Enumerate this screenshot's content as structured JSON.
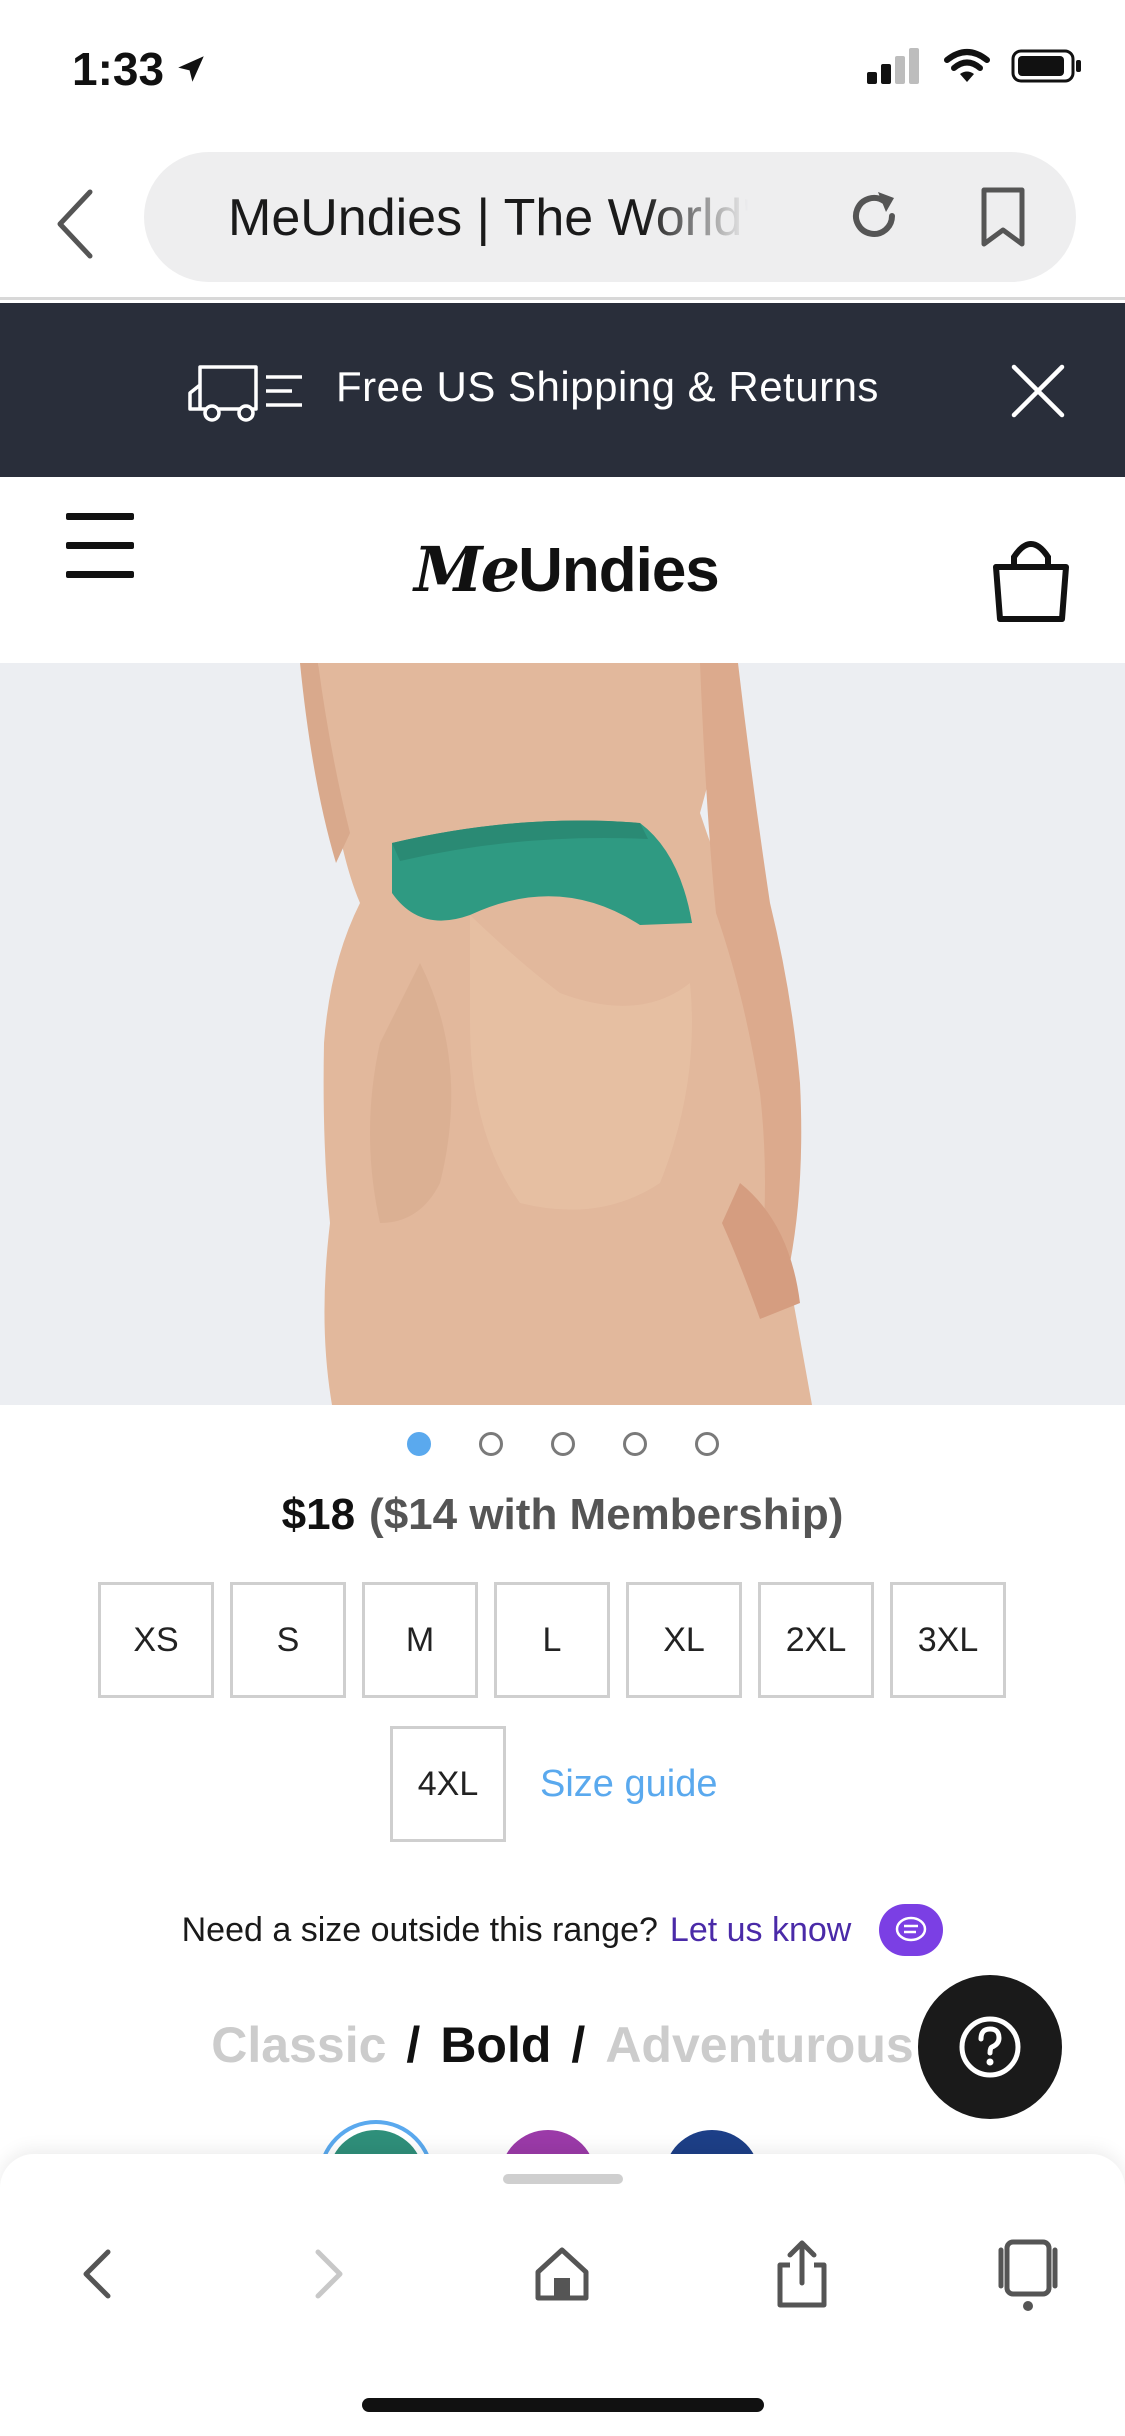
{
  "status_bar": {
    "time": "1:33"
  },
  "browser": {
    "url_text": "MeUndies | The World'",
    "icons": [
      "back-icon",
      "reload-icon",
      "bookmark-icon"
    ]
  },
  "banner": {
    "text": "Free US Shipping & Returns",
    "icons": [
      "truck-icon",
      "close-icon"
    ]
  },
  "header": {
    "logo_me": "Me",
    "logo_undies": "Undies",
    "icons": [
      "hamburger-menu-icon",
      "shopping-bag-icon"
    ]
  },
  "carousel": {
    "total": 5,
    "active_index": 0,
    "active_color": "#5aa9ee"
  },
  "product": {
    "price": "$18",
    "member_price": "($14 with Membership)",
    "sizes": [
      "XS",
      "S",
      "M",
      "L",
      "XL",
      "2XL",
      "3XL"
    ],
    "sizes_row2": [
      "4XL"
    ],
    "size_guide": "Size guide",
    "need_size_text": "Need a size outside this range?",
    "need_size_link": "Let us know",
    "style_tabs": [
      {
        "label": "Classic",
        "active": false
      },
      {
        "label": "Bold",
        "active": true
      },
      {
        "label": "Adventurous",
        "active": false
      }
    ],
    "separator": "/",
    "swatch_colors": [
      "#2f8f7a",
      "#9b3aa8",
      "#1d3f87"
    ]
  },
  "bottom_nav": {
    "icons": [
      "back-arrow-icon",
      "forward-arrow-icon",
      "home-icon",
      "share-icon",
      "tabs-icon"
    ]
  },
  "colors": {
    "banner_bg": "#292e3a",
    "link_blue": "#5aa9ee",
    "link_purple": "#4a2aa8",
    "chat_purple": "#7b3fe4"
  }
}
